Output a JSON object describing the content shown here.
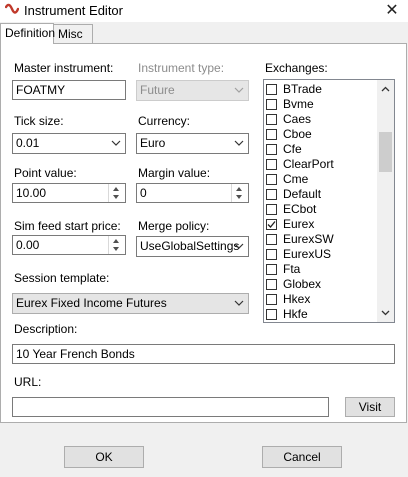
{
  "window": {
    "title": "Instrument Editor",
    "close_glyph": "✕"
  },
  "tabs": [
    {
      "label": "Definition"
    },
    {
      "label": "Misc"
    }
  ],
  "fields": {
    "master_instrument": {
      "label": "Master instrument:",
      "value": "FOATMY"
    },
    "instrument_type": {
      "label": "Instrument type:",
      "value": "Future"
    },
    "tick_size": {
      "label": "Tick size:",
      "value": "0.01"
    },
    "currency": {
      "label": "Currency:",
      "value": "Euro"
    },
    "point_value": {
      "label": "Point value:",
      "value": "10.00"
    },
    "margin_value": {
      "label": "Margin value:",
      "value": "0"
    },
    "sim_feed_start_price": {
      "label": "Sim feed start price:",
      "value": "0.00"
    },
    "merge_policy": {
      "label": "Merge policy:",
      "value": "UseGlobalSettings"
    },
    "session_template": {
      "label": "Session template:",
      "value": "Eurex Fixed Income Futures"
    },
    "description": {
      "label": "Description:",
      "value": "10 Year French Bonds"
    },
    "url": {
      "label": "URL:",
      "value": ""
    }
  },
  "exchanges": {
    "label": "Exchanges:",
    "items": [
      {
        "name": "BTrade",
        "checked": false
      },
      {
        "name": "Bvme",
        "checked": false
      },
      {
        "name": "Caes",
        "checked": false
      },
      {
        "name": "Cboe",
        "checked": false
      },
      {
        "name": "Cfe",
        "checked": false
      },
      {
        "name": "ClearPort",
        "checked": false
      },
      {
        "name": "Cme",
        "checked": false
      },
      {
        "name": "Default",
        "checked": false
      },
      {
        "name": "ECbot",
        "checked": false
      },
      {
        "name": "Eurex",
        "checked": true
      },
      {
        "name": "EurexSW",
        "checked": false
      },
      {
        "name": "EurexUS",
        "checked": false
      },
      {
        "name": "Fta",
        "checked": false
      },
      {
        "name": "Globex",
        "checked": false
      },
      {
        "name": "Hkex",
        "checked": false
      },
      {
        "name": "Hkfe",
        "checked": false
      }
    ]
  },
  "buttons": {
    "visit": "Visit",
    "ok": "OK",
    "cancel": "Cancel"
  },
  "colors": {
    "app_icon": "#c0392b"
  }
}
